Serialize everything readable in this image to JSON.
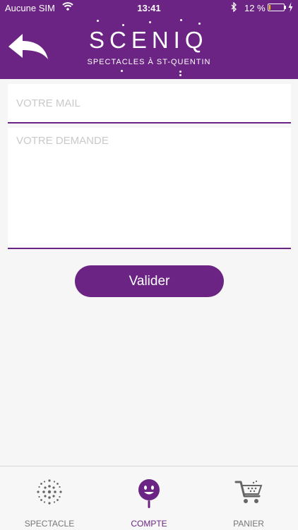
{
  "status_bar": {
    "carrier": "Aucune SIM",
    "time": "13:41",
    "battery_percent": "12 %",
    "battery_level": 0.12
  },
  "header": {
    "logo_text": "SCENIQ",
    "subtitle": "SPECTACLES À ST-QUENTIN",
    "back_icon": "back-arrow-icon"
  },
  "form": {
    "mail_placeholder": "VOTRE MAIL",
    "mail_value": "",
    "demande_placeholder": "VOTRE DEMANDE",
    "demande_value": "",
    "submit_label": "Valider"
  },
  "tabbar": {
    "tabs": [
      {
        "label": "SPECTACLE",
        "icon": "spectacle-burst-icon",
        "active": false
      },
      {
        "label": "COMPTE",
        "icon": "account-face-icon",
        "active": true
      },
      {
        "label": "PANIER",
        "icon": "cart-icon",
        "active": false
      }
    ]
  },
  "colors": {
    "brand": "#6b2483",
    "background": "#f6f6f6",
    "placeholder": "#c9c9c9",
    "battery_fill": "#f5c400"
  }
}
